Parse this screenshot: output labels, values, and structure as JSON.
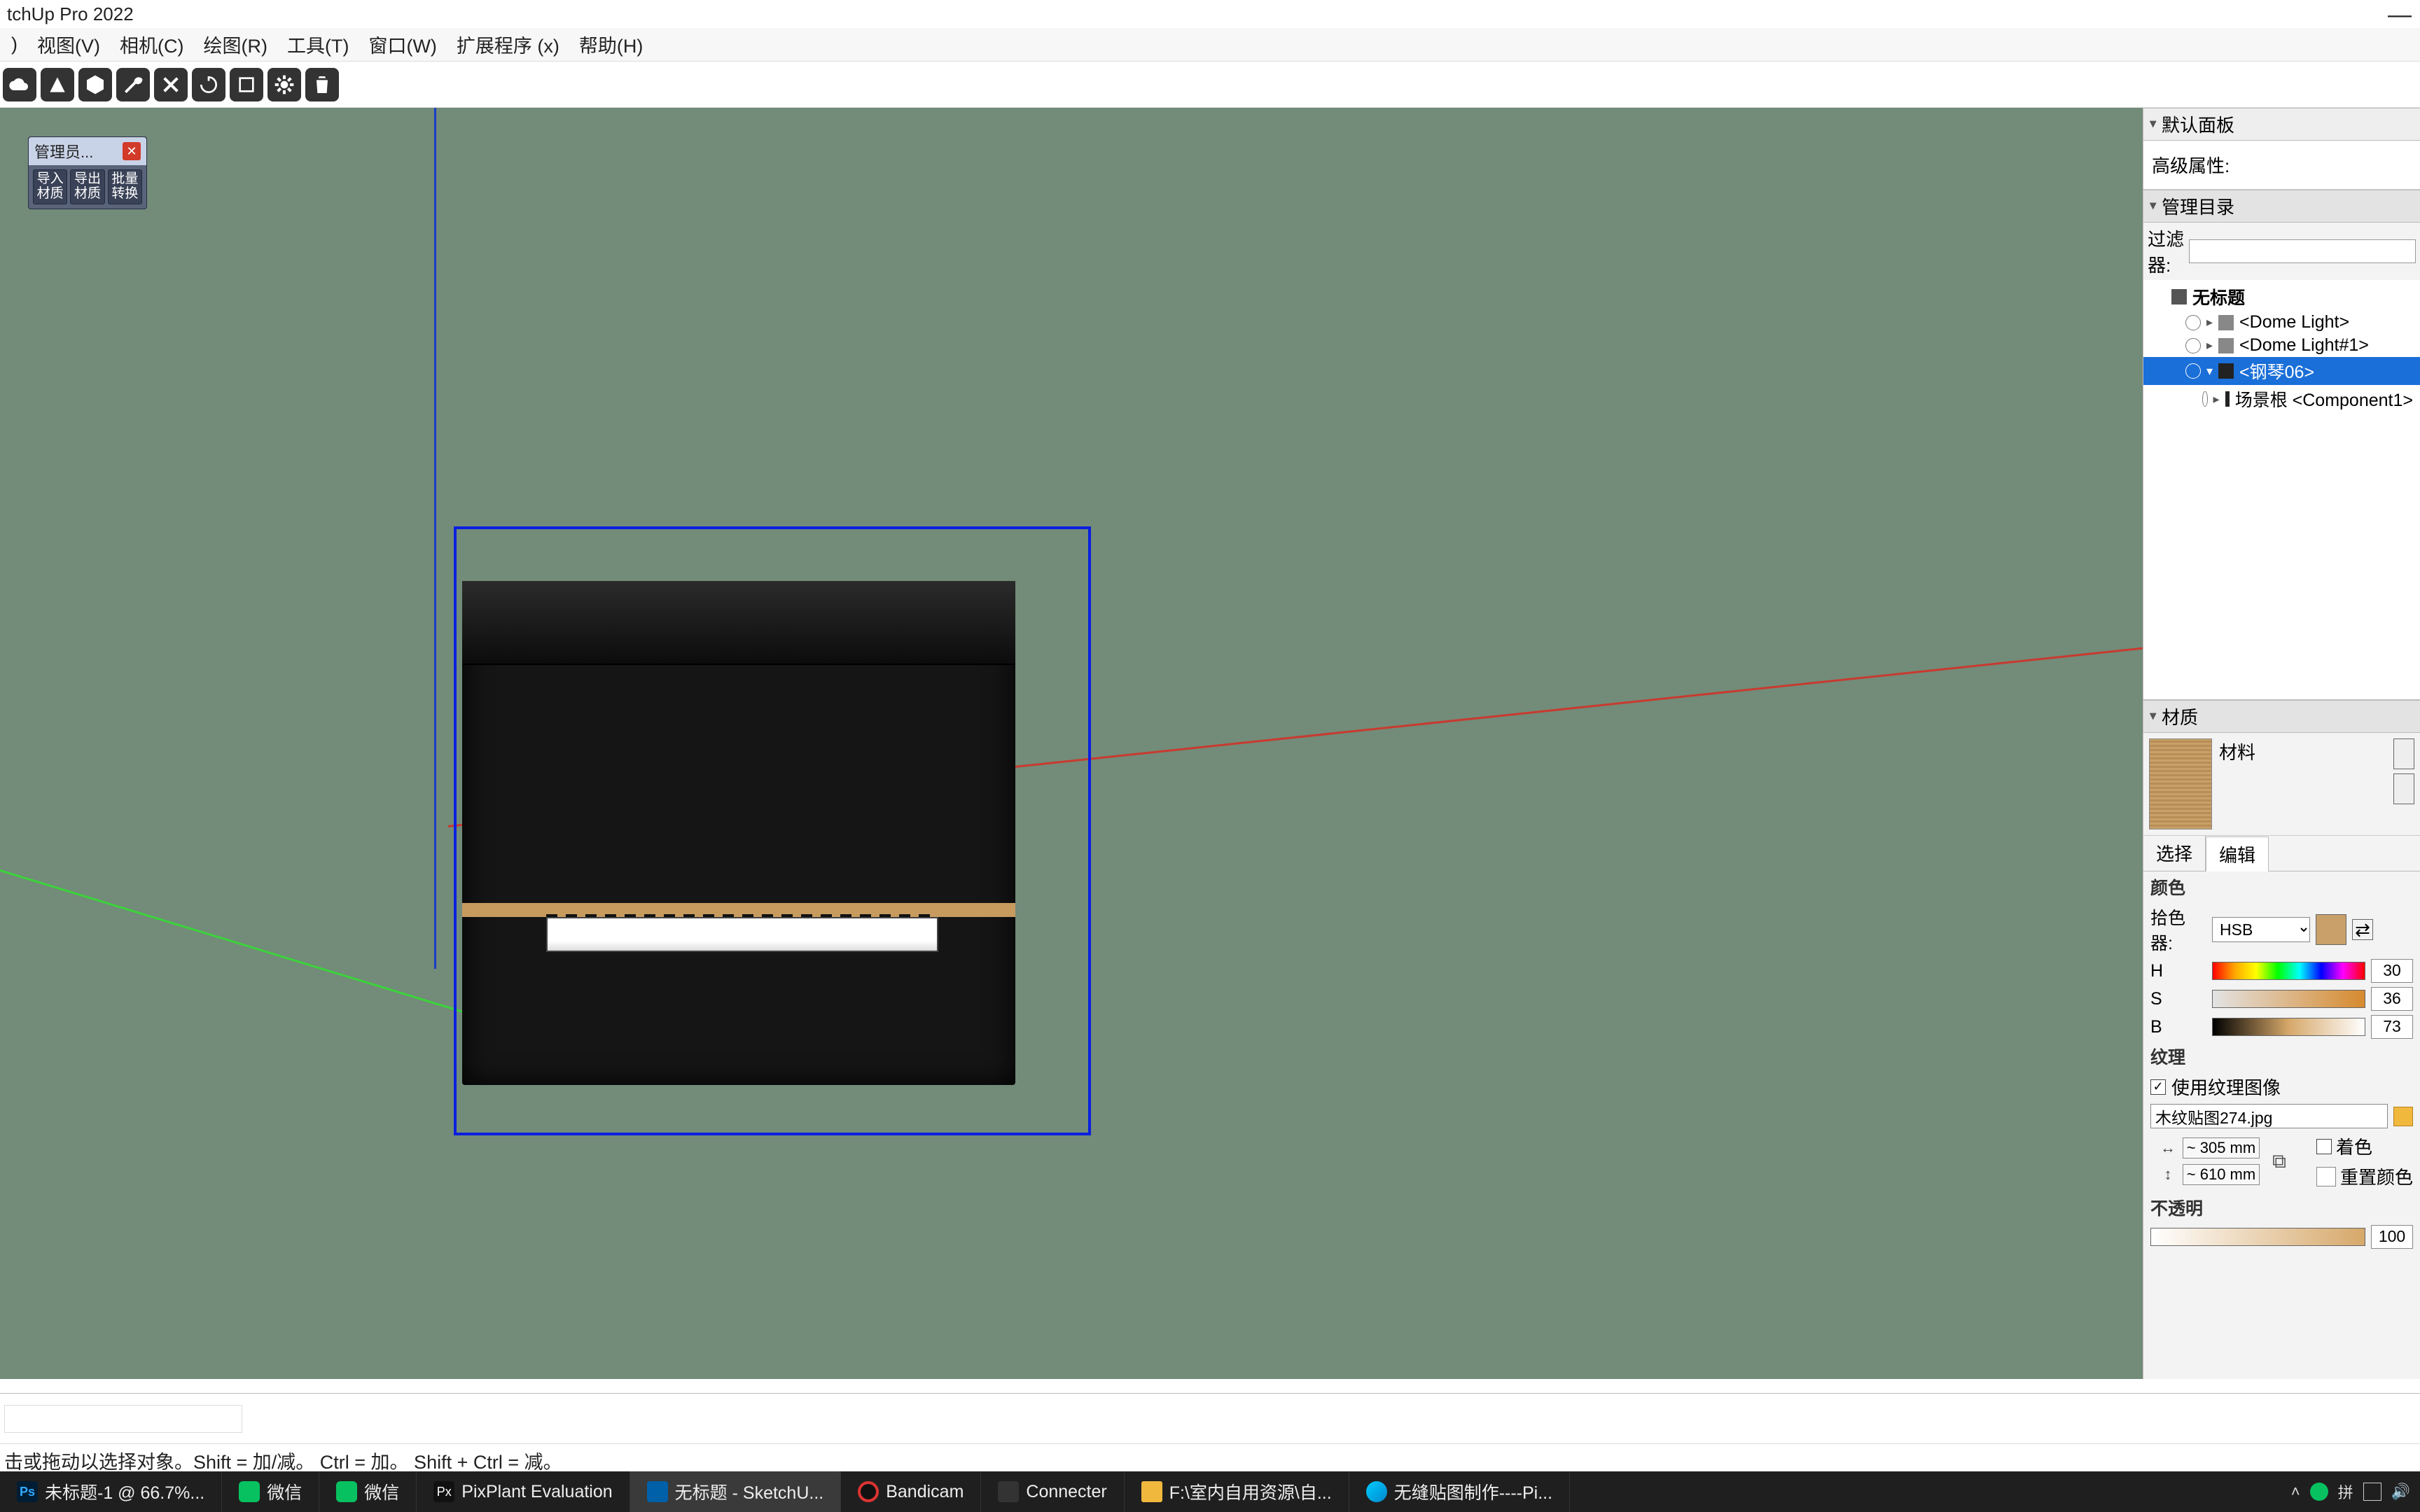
{
  "title_bar": {
    "app_title": "tchUp Pro 2022",
    "min_symbol": "—"
  },
  "menus": {
    "txt": ")",
    "view": "视图(V)",
    "camera": "相机(C)",
    "draw": "绘图(R)",
    "tool": "工具(T)",
    "window": "窗口(W)",
    "ext": "扩展程序 (x)",
    "help": "帮助(H)"
  },
  "panel": {
    "default_panel": "默认面板",
    "adv_attr": "高级属性:",
    "manage_dir": "管理目录",
    "filter_label": "过滤器:",
    "outliner": {
      "root": "无标题",
      "i1": "<Dome Light>",
      "i2": "<Dome Light#1>",
      "i3": "<钢琴06>",
      "i4": "场景根 <Component1>"
    },
    "material_section": "材质",
    "material_name": "材料",
    "tab_select": "选择",
    "tab_edit": "编辑",
    "color_header": "颜色",
    "picker_label": "拾色器:",
    "picker_value": "HSB",
    "h_label": "H",
    "h_val": "30",
    "s_label": "S",
    "s_val": "36",
    "b_label": "B",
    "b_val": "73",
    "texture_header": "纹理",
    "use_texture": "使用纹理图像",
    "texture_file": "木纹贴图274.jpg",
    "dim_w": "~ 305 mm",
    "dim_h": "~ 610 mm",
    "colorize": "着色",
    "reset_color": "重置颜色",
    "opacity_header": "不透明",
    "opacity_val": "100"
  },
  "manager": {
    "title": "管理员...",
    "b1a": "导入",
    "b1b": "材质",
    "b2a": "导出",
    "b2b": "材质",
    "b3a": "批量",
    "b3b": "转换"
  },
  "hint": "击或拖动以选择对象。Shift = 加/减。 Ctrl = 加。 Shift + Ctrl = 减。",
  "taskbar": {
    "t1": "未标题-1 @ 66.7%...",
    "t2": "微信",
    "t3": "微信",
    "t4": "PixPlant Evaluation",
    "t5": "无标题 - SketchU...",
    "t6": "Bandicam",
    "t7": "Connecter",
    "t8": "F:\\室内自用资源\\自...",
    "t9": "无缝贴图制作----Pi..."
  }
}
